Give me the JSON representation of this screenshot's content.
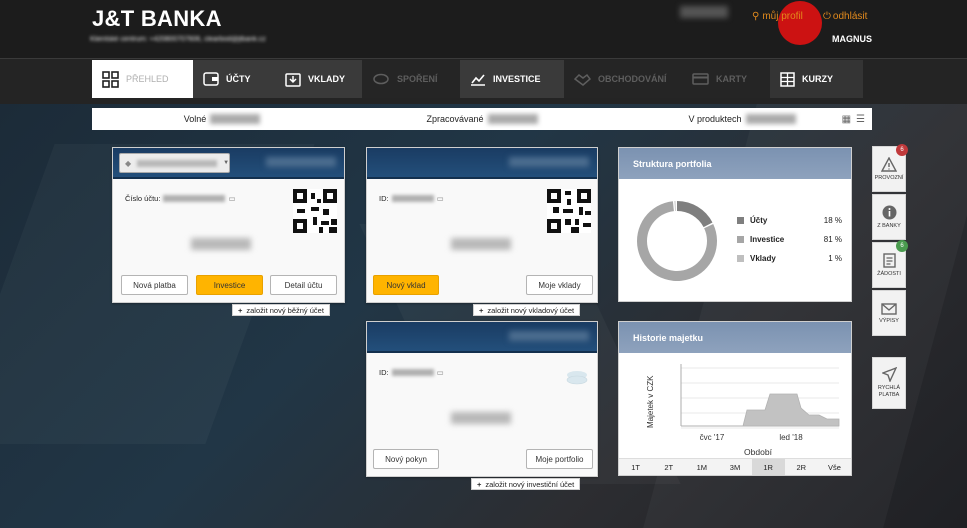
{
  "brand": {
    "logo": "J&T BANKA",
    "contact": "Klientské centrum: +420800707606, clearbod@jtbank.cz"
  },
  "header": {
    "profile_link": "můj profil",
    "logout_link": "odhlásit",
    "user_name": "MAGNUS"
  },
  "nav": {
    "tabs": [
      {
        "label": "PŘEHLED",
        "icon": "grid-icon",
        "state": "active"
      },
      {
        "label": "ÚČTY",
        "icon": "wallet-icon",
        "state": "normal"
      },
      {
        "label": "VKLADY",
        "icon": "deposit-icon",
        "state": "normal"
      },
      {
        "label": "SPOŘENÍ",
        "icon": "piggy-icon",
        "state": "disabled"
      },
      {
        "label": "INVESTICE",
        "icon": "chart-line-icon",
        "state": "normal"
      },
      {
        "label": "OBCHODOVÁNÍ",
        "icon": "handshake-icon",
        "state": "disabled"
      },
      {
        "label": "KARTY",
        "icon": "card-icon",
        "state": "disabled"
      },
      {
        "label": "KURZY",
        "icon": "table-icon",
        "state": "normal"
      }
    ]
  },
  "summary": {
    "free_label": "Volné",
    "processing_label": "Zpracovávané",
    "products_label": "V produktech"
  },
  "account_card": {
    "number_label": "Číslo účtu:",
    "buttons": {
      "payment": "Nová platba",
      "investice": "Investice",
      "detail": "Detail účtu"
    },
    "add_link": "založit nový běžný účet",
    "amount": "46,22 CZK"
  },
  "deposit_card": {
    "id_label": "ID:",
    "buttons": {
      "new": "Nový vklad",
      "mine": "Moje vklady"
    },
    "add_link": "založit nový vkladový účet",
    "amount": "46,22 CZK"
  },
  "invest_card": {
    "id_label": "ID:",
    "buttons": {
      "new": "Nový pokyn",
      "mine": "Moje portfolio"
    },
    "add_link": "založit nový investiční účet",
    "amount": "46,22 CZK"
  },
  "portfolio": {
    "title": "Struktura portfolia",
    "items": [
      {
        "label": "Účty",
        "pct": "18 %",
        "color": "#7f7f7f"
      },
      {
        "label": "Investice",
        "pct": "81 %",
        "color": "#a6a6a6"
      },
      {
        "label": "Vklady",
        "pct": "1 %",
        "color": "#bfbfbf"
      }
    ]
  },
  "history": {
    "title": "Historie majetku",
    "ylabel": "Majetek v CZK",
    "xlabel": "Období",
    "ticks": [
      "čvc '17",
      "led '18"
    ],
    "periods": [
      "1T",
      "2T",
      "1M",
      "3M",
      "1R",
      "2R",
      "Vše"
    ],
    "selected_period": "1R"
  },
  "sidebar": {
    "items": [
      {
        "label": "PROVOZNÍ",
        "icon": "warning-icon",
        "badge": "6",
        "badge_color": "#c0393b"
      },
      {
        "label": "Z BANKY",
        "icon": "info-icon",
        "badge": "",
        "badge_color": ""
      },
      {
        "label": "ŽÁDOSTI",
        "icon": "document-icon",
        "badge": "6",
        "badge_color": "#4a9b4f"
      },
      {
        "label": "VÝPISY",
        "icon": "envelope-icon",
        "badge": "",
        "badge_color": ""
      },
      {
        "label": "RYCHLÁ PLATBA",
        "icon": "send-icon",
        "badge": "",
        "badge_color": ""
      }
    ]
  },
  "colors": {
    "accent": "#ffb400",
    "brand_orange": "#e28a1c",
    "card_header": "#1f4670",
    "panel_header": "#8499b6"
  }
}
